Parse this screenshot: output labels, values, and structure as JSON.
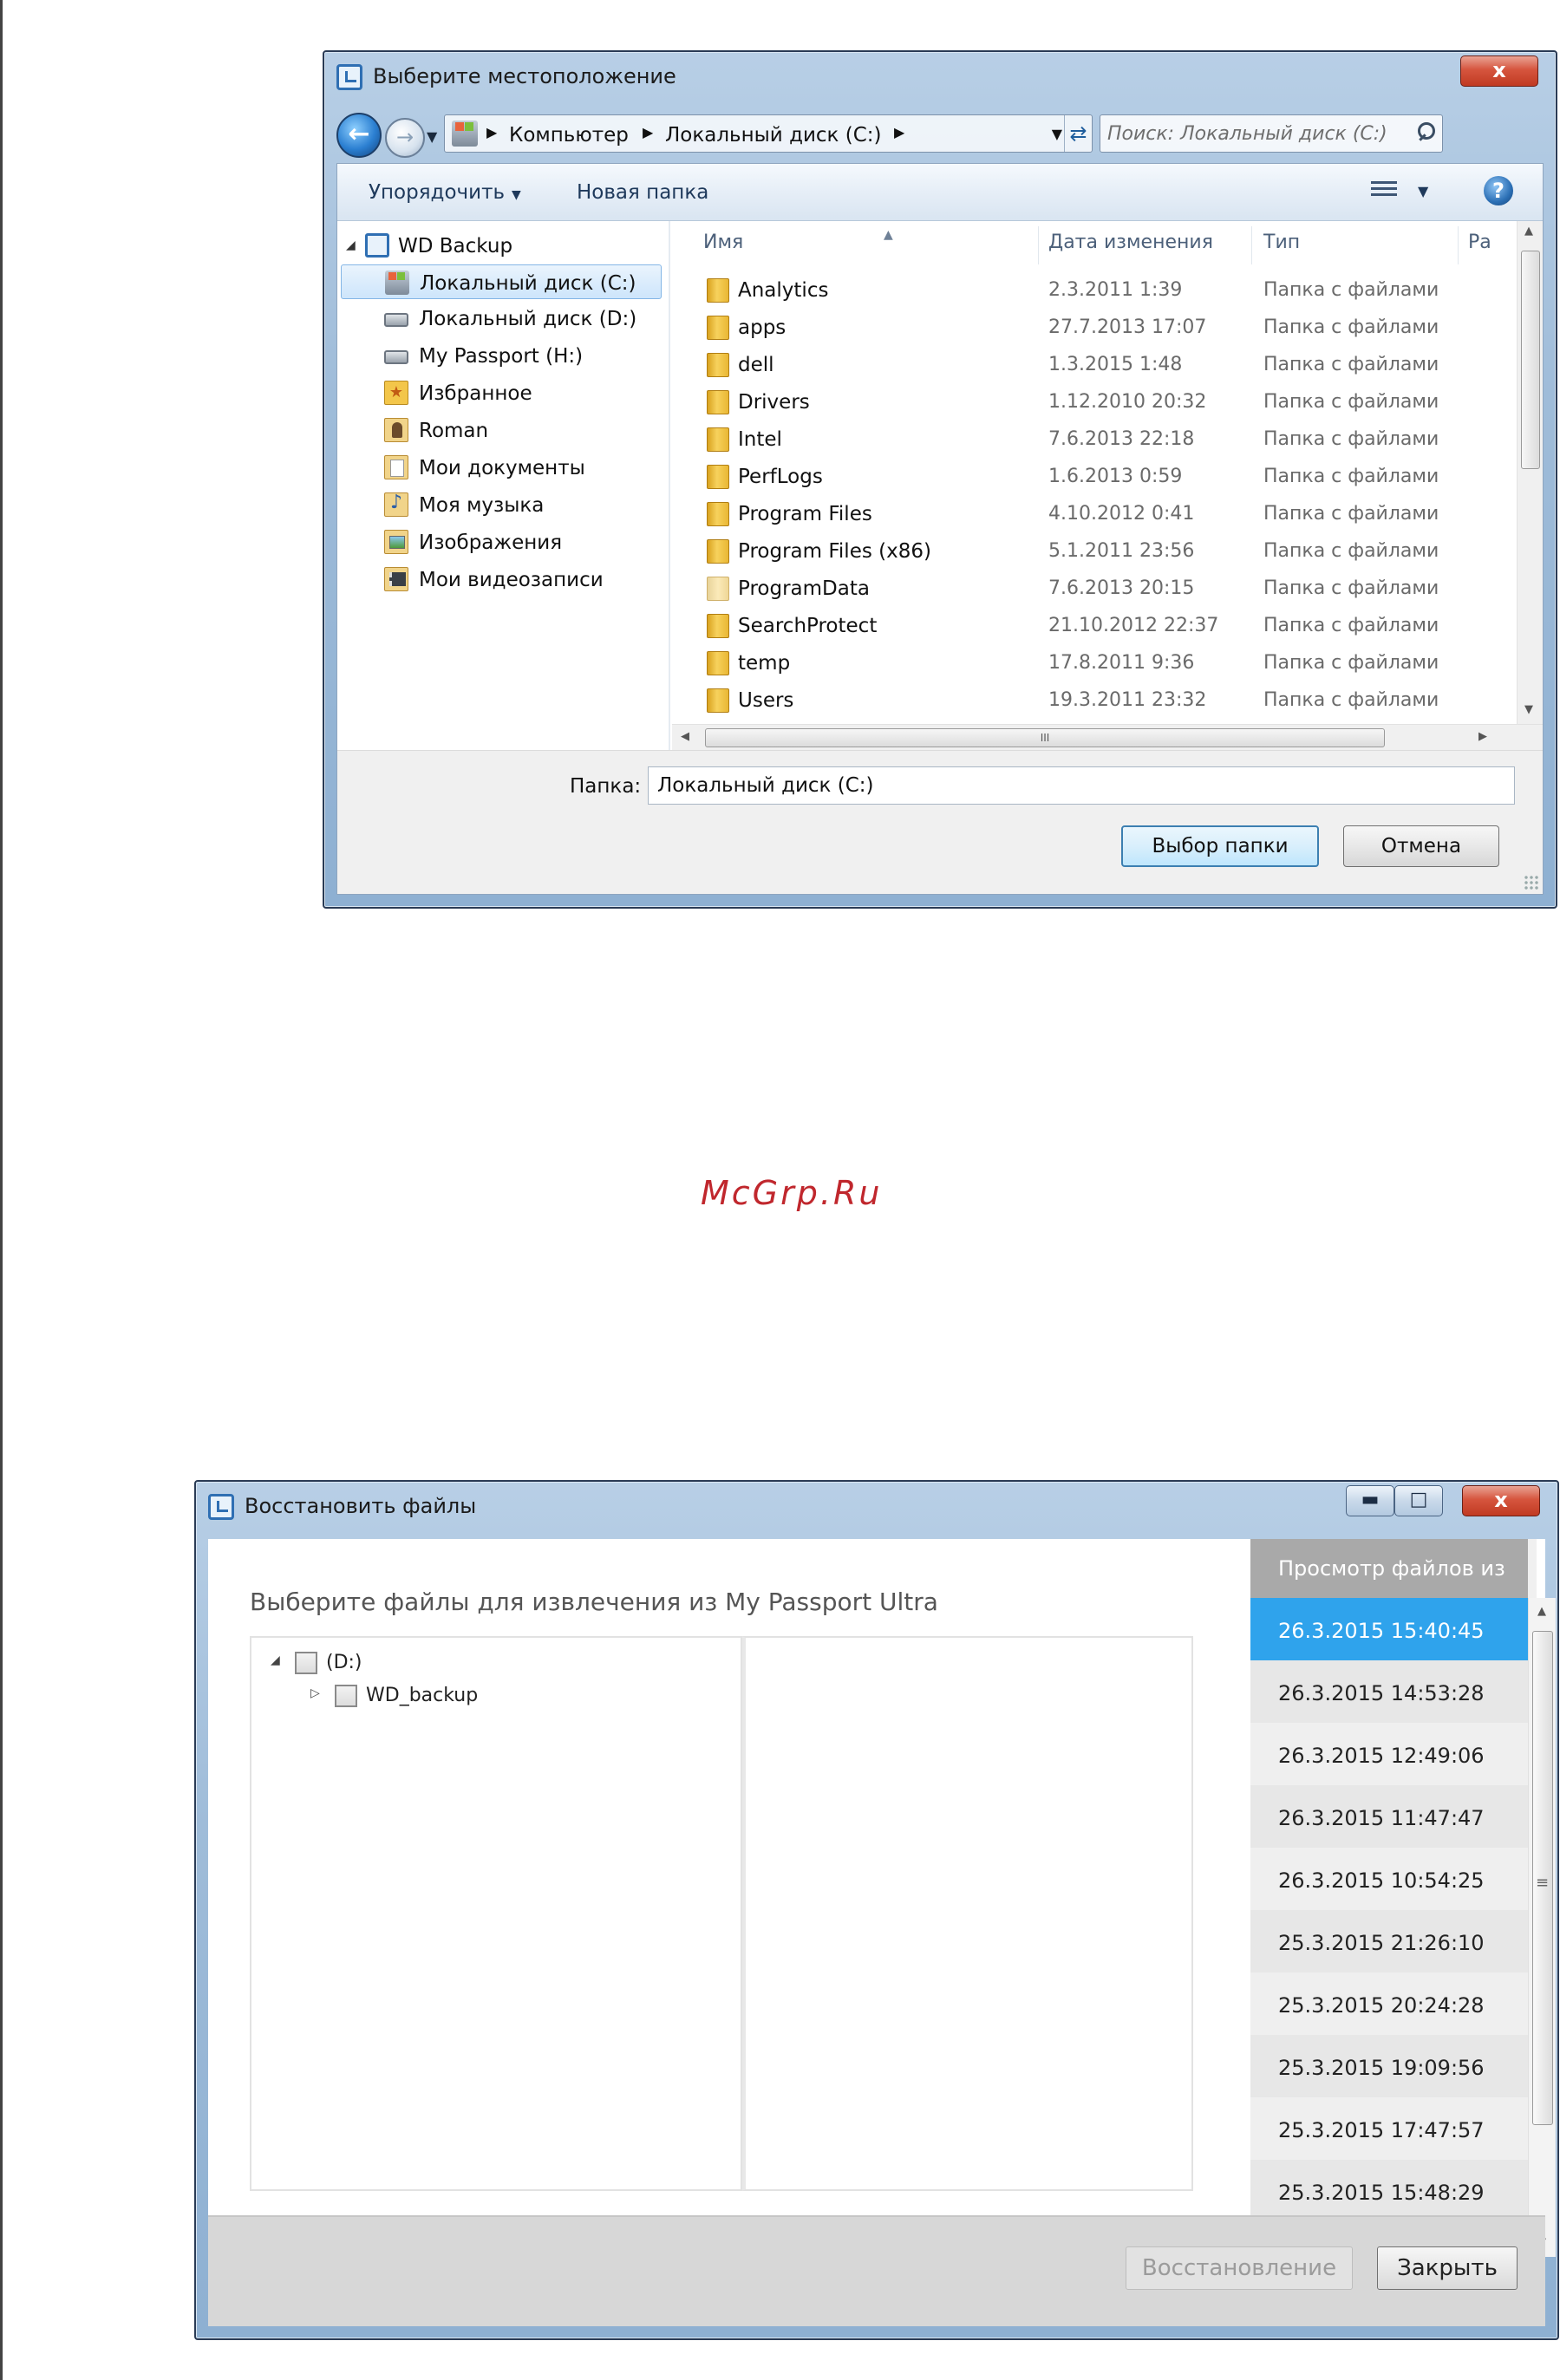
{
  "dialog1": {
    "title": "Выберите местоположение",
    "close_glyph": "x",
    "address": {
      "crumbs": [
        "Компьютер",
        "Локальный диск (C:)"
      ],
      "search_placeholder": "Поиск: Локальный диск (C:)"
    },
    "toolbar": {
      "organize": "Упорядочить",
      "new_folder": "Новая папка"
    },
    "nav": {
      "root": "WD Backup",
      "items": [
        {
          "label": "Локальный диск (C:)",
          "icon": "system-drive-icon"
        },
        {
          "label": "Локальный диск (D:)",
          "icon": "drive-icon"
        },
        {
          "label": "My Passport (H:)",
          "icon": "drive-icon"
        },
        {
          "label": "Избранное",
          "icon": "favorites-icon"
        },
        {
          "label": "Roman",
          "icon": "user-folder-icon"
        },
        {
          "label": "Мои документы",
          "icon": "documents-icon"
        },
        {
          "label": "Моя музыка",
          "icon": "music-icon"
        },
        {
          "label": "Изображения",
          "icon": "pictures-icon"
        },
        {
          "label": "Мои видеозаписи",
          "icon": "videos-icon"
        }
      ]
    },
    "columns": {
      "name": "Имя",
      "date": "Дата изменения",
      "type": "Тип",
      "size": "Ра"
    },
    "files": [
      {
        "name": "Analytics",
        "date": "2.3.2011 1:39",
        "type": "Папка с файлами"
      },
      {
        "name": "apps",
        "date": "27.7.2013 17:07",
        "type": "Папка с файлами"
      },
      {
        "name": "dell",
        "date": "1.3.2015 1:48",
        "type": "Папка с файлами"
      },
      {
        "name": "Drivers",
        "date": "1.12.2010 20:32",
        "type": "Папка с файлами"
      },
      {
        "name": "Intel",
        "date": "7.6.2013 22:18",
        "type": "Папка с файлами"
      },
      {
        "name": "PerfLogs",
        "date": "1.6.2013 0:59",
        "type": "Папка с файлами"
      },
      {
        "name": "Program Files",
        "date": "4.10.2012 0:41",
        "type": "Папка с файлами"
      },
      {
        "name": "Program Files (x86)",
        "date": "5.1.2011 23:56",
        "type": "Папка с файлами"
      },
      {
        "name": "ProgramData",
        "date": "7.6.2013 20:15",
        "type": "Папка с файлами"
      },
      {
        "name": "SearchProtect",
        "date": "21.10.2012 22:37",
        "type": "Папка с файлами"
      },
      {
        "name": "temp",
        "date": "17.8.2011 9:36",
        "type": "Папка с файлами"
      },
      {
        "name": "Users",
        "date": "19.3.2011 23:32",
        "type": "Папка с файлами"
      }
    ],
    "hscroll_grip": "III",
    "folder_label": "Папка:",
    "folder_value": "Локальный диск (C:)",
    "select_button": "Выбор папки",
    "cancel_button": "Отмена"
  },
  "watermark": "McGrp.Ru",
  "dialog2": {
    "title": "Восстановить файлы",
    "close_glyph": "x",
    "heading": "Выберите файлы для извлечения из My Passport Ultra",
    "tree": [
      {
        "label": "(D:)",
        "expanded": true
      },
      {
        "label": "WD_backup",
        "expanded": false
      }
    ],
    "sidebar_title": "Просмотр файлов из",
    "snapshots": [
      "26.3.2015 15:40:45",
      "26.3.2015 14:53:28",
      "26.3.2015 12:49:06",
      "26.3.2015 11:47:47",
      "26.3.2015 10:54:25",
      "25.3.2015 21:26:10",
      "25.3.2015 20:24:28",
      "25.3.2015 19:09:56",
      "25.3.2015 17:47:57",
      "25.3.2015 15:48:29"
    ],
    "selected_snapshot": 0,
    "restore_button": "Восстановление",
    "close_button": "Закрыть"
  },
  "colors": {
    "selection_blue": "#2fa3ec",
    "watermark_red": "#c0272d",
    "close_red": "#c03a22"
  }
}
